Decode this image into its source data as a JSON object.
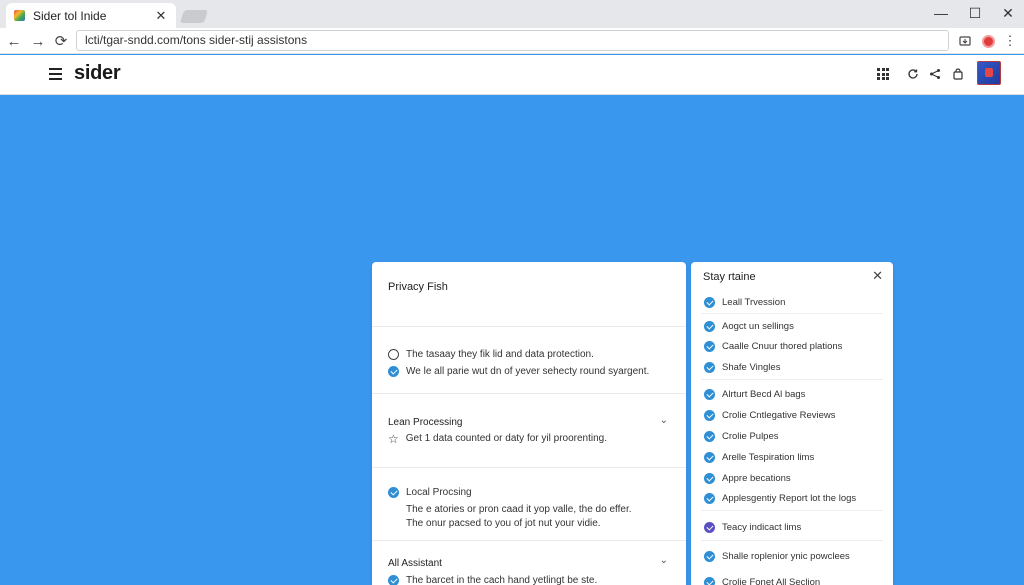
{
  "browser": {
    "tab_title": "Sider tol Inide",
    "tab_close": "✕",
    "url": "lcti/tgar-sndd.com/tons sider-stij assistons",
    "back": "←",
    "forward": "→",
    "reload": "⟳",
    "minimize": "—",
    "maximize": "☐",
    "close": "✕",
    "menu": "⋮"
  },
  "app": {
    "brand": "sider"
  },
  "privacy_panel": {
    "title": "Privacy Fish",
    "options": [
      "The tasaay they fik lid and data protection.",
      "We le all parie wut dn of yever sehecty round syargent."
    ],
    "sections": [
      {
        "title": "Lean Processing",
        "item": "Get 1 data counted or daty for yil proorenting."
      },
      {
        "title": "Local Procsing",
        "desc": [
          "The e atories or pron caad it yop valle, the do effer.",
          "The onur pacsed to you of jot nut your vidie."
        ]
      },
      {
        "title": "All Assistant",
        "item": "The barcet in the cach hand yetlingt be ste."
      }
    ],
    "chevron": "⌄"
  },
  "stay_panel": {
    "title": "Stay rtaine",
    "close": "✕",
    "items": [
      "Leall Trvession",
      "Aogct un sellings",
      "Caalle Cnuur thored plations",
      "Shafe Vingles",
      "Alrturt Becd Al bags",
      "Crolie Cntlegative Reviews",
      "Crolie Pulpes",
      "Arelle Tespiration lims",
      "Appre becations",
      "Applesgentiy Report lot the logs",
      "Teacy indicact lims",
      "Shalle roplenior ynic powclees",
      "Crolie Fonet All Seclion"
    ]
  }
}
